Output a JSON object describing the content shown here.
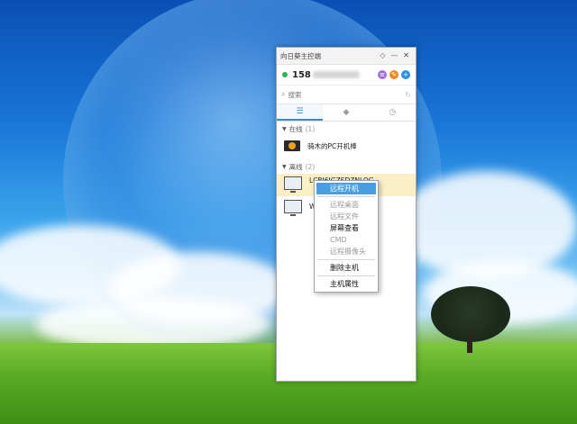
{
  "window": {
    "title": "向日葵主控端",
    "buttons": {
      "pin": "◇",
      "minimize": "—",
      "close": "✕"
    }
  },
  "account": {
    "id_prefix": "158"
  },
  "search": {
    "placeholder": "搜索"
  },
  "tabs": [
    {
      "icon": "list-icon",
      "active": true
    },
    {
      "icon": "tag-icon",
      "active": false
    },
    {
      "icon": "clock-icon",
      "active": false
    }
  ],
  "groups": {
    "online": {
      "label": "在线",
      "count": "(1)"
    },
    "offline": {
      "label": "离线",
      "count": "(2)"
    }
  },
  "devices": {
    "online_1": {
      "name": "骑木的PC开机棒"
    },
    "offline_1": {
      "name": "LCBJ6JGZSDZNLOG"
    },
    "offline_2": {
      "name": "W"
    }
  },
  "context_menu": [
    {
      "label": "远程开机",
      "state": "highlighted"
    },
    {
      "label": "远程桌面",
      "state": "disabled"
    },
    {
      "label": "远程文件",
      "state": "disabled"
    },
    {
      "label": "屏幕查看",
      "state": "normal"
    },
    {
      "label": "CMD",
      "state": "disabled"
    },
    {
      "label": "远程摄像头",
      "state": "disabled"
    },
    {
      "label": "删除主机",
      "state": "normal"
    },
    {
      "label": "主机属性",
      "state": "normal"
    }
  ],
  "colors": {
    "accent": "#3a88d8",
    "selected_row": "#fcefc6",
    "menu_highlight": "#4a9fe0",
    "online_dot": "#2db44a"
  }
}
